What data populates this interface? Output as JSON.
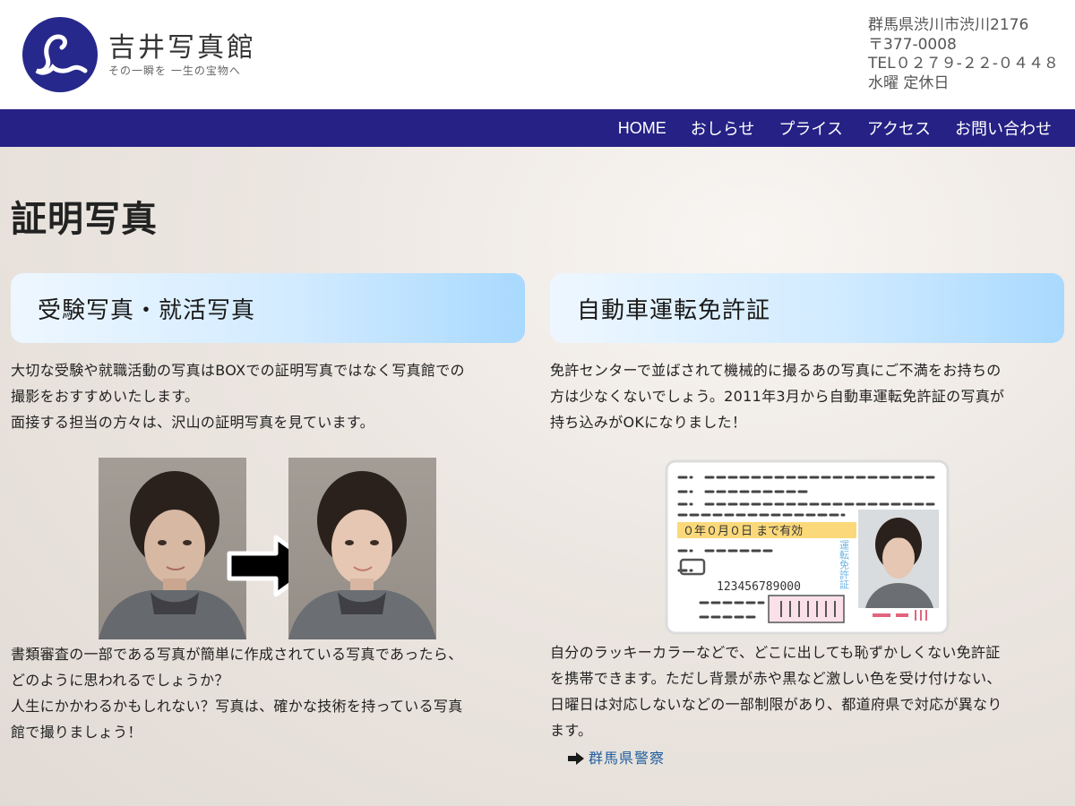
{
  "header": {
    "title": "吉井写真館",
    "tagline": "その一瞬を 一生の宝物へ",
    "contact": {
      "address": "群馬県渋川市渋川2176",
      "postal": "〒377-0008",
      "tel": "TEL０２７９-２２-０４４８",
      "holiday": "水曜 定休日"
    }
  },
  "nav": {
    "items": [
      {
        "label": "HOME"
      },
      {
        "label": "おしらせ"
      },
      {
        "label": "プライス"
      },
      {
        "label": "アクセス"
      },
      {
        "label": "お問い合わせ"
      }
    ]
  },
  "page": {
    "title": "証明写真"
  },
  "sections": {
    "left": {
      "heading": "受験写真・就活写真",
      "intro": [
        "大切な受験や就職活動の写真はBOXでの証明写真ではなく写真館での",
        "撮影をおすすめいたします。",
        "面接する担当の方々は、沢山の証明写真を見ています。"
      ],
      "outro": [
        "書類審査の一部である写真が簡単に作成されている写真であったら、",
        "どのように思われるでしょうか？",
        "人生にかかわるかもしれない？写真は、確かな技術を持っている写真",
        "館で撮りましょう！"
      ]
    },
    "right": {
      "heading": "自動車運転免許証",
      "intro": [
        "免許センターで並ばされて機械的に撮るあの写真にご不満をお持ちの",
        "方は少なくないでしょう。2011年3月から自動車運転免許証の写真が",
        "持ち込みがOKになりました！"
      ],
      "outro": [
        "自分のラッキーカラーなどで、どこに出しても恥ずかしくない免許証",
        "を携帯できます。ただし背景が赤や黒など激しい色を受け付けない、",
        "日曜日は対応しないなどの一部制限があり、都道府県で対応が異なり",
        "ます。"
      ],
      "link": "群馬県警察",
      "license": {
        "expiry": "０年０月０日 まで有効",
        "number": "123456789000",
        "vertical": "運転免許証"
      }
    }
  },
  "colors": {
    "nav_bg": "#252185",
    "logo_bg": "#26288b",
    "heading_grad_end": "#a9d9ff",
    "link": "#1f5f9f"
  }
}
